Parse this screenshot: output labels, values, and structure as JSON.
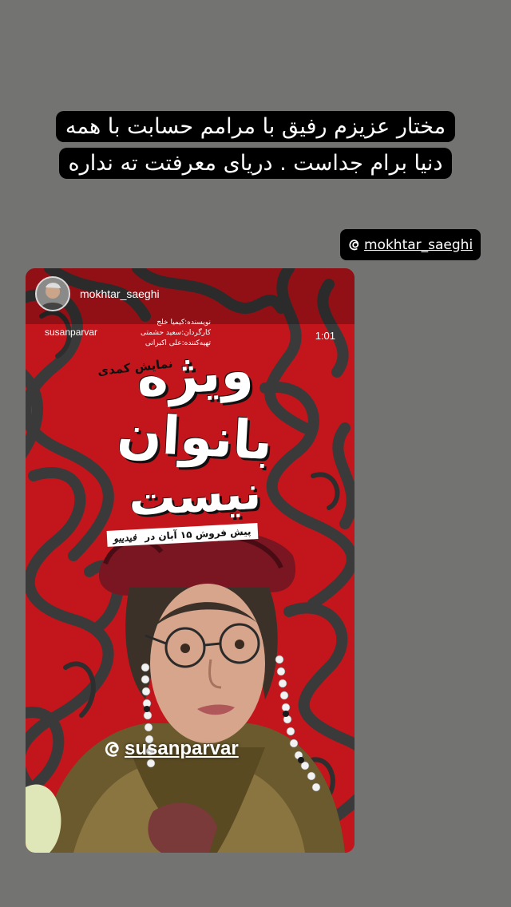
{
  "caption": {
    "text": "مختار عزیزم رفیق با مرامم حسابت با همه دنیا برام جداست . دریای معرفتت ته نداره"
  },
  "mention_top": {
    "handle": "mokhtar_saeghi"
  },
  "shared_post": {
    "username": "mokhtar_saeghi",
    "inner_username": "susanparvar",
    "duration": "1:01",
    "poster": {
      "credits": [
        "نویسنده:کیمیا خلج",
        "کارگردان:سعید حشمتی",
        "تهیه‌کننده:علی اکبرانی"
      ],
      "subtitle": "نمایش کمدی",
      "title_line1": "ویژه",
      "title_line2": "بانوان",
      "title_line3": "نیست",
      "presale": "پیش فروش ۱۵ آبان در",
      "presale_brand": "فیدیبو"
    },
    "mention": {
      "handle": "susanparvar"
    }
  },
  "colors": {
    "background": "#737372",
    "poster_red": "#c2161c",
    "poster_dark": "#3a3a3a"
  },
  "icons": {
    "threads": "threads-icon"
  }
}
